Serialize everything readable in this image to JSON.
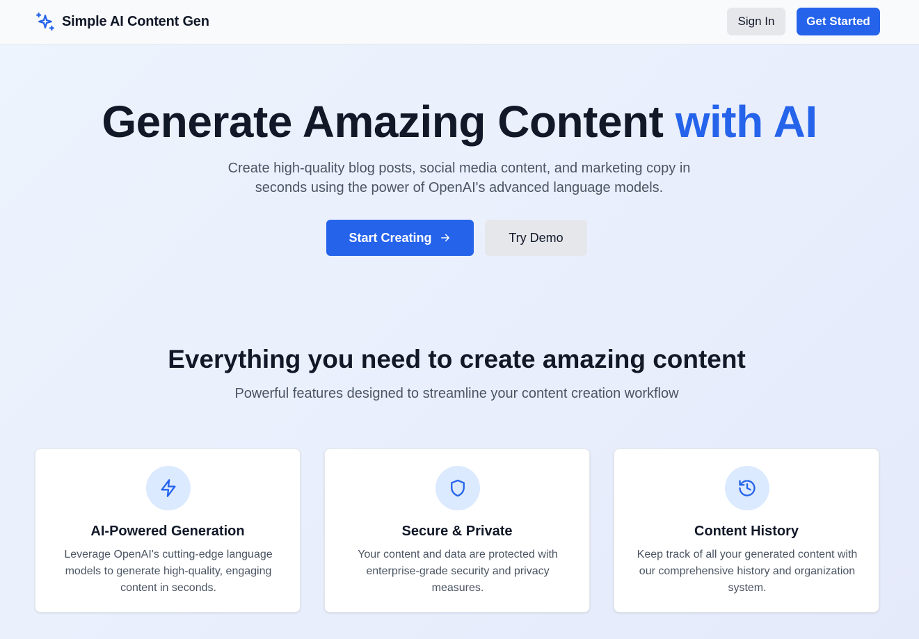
{
  "nav": {
    "brand": "Simple AI Content Gen",
    "brand_icon": "sparkles-icon",
    "signin_label": "Sign In",
    "getstarted_label": "Get Started"
  },
  "hero": {
    "title_main": "Generate Amazing Content ",
    "title_accent": "with AI",
    "subtitle": "Create high-quality blog posts, social media content, and marketing copy in seconds using the power of OpenAI's advanced language models.",
    "primary_cta": "Start Creating",
    "secondary_cta": "Try Demo"
  },
  "features": {
    "title": "Everything you need to create amazing content",
    "subtitle": "Powerful features designed to streamline your content creation workflow",
    "cards": [
      {
        "icon": "lightning-bolt-icon",
        "title": "AI-Powered Generation",
        "description": "Leverage OpenAI's cutting-edge language models to generate high-quality, engaging content in seconds."
      },
      {
        "icon": "shield-icon",
        "title": "Secure & Private",
        "description": "Your content and data are protected with enterprise-grade security and privacy measures."
      },
      {
        "icon": "history-icon",
        "title": "Content History",
        "description": "Keep track of all your generated content with our comprehensive history and organization system."
      }
    ]
  },
  "colors": {
    "accent": "#2563eb",
    "text": "#111827",
    "muted": "#4b5563",
    "icon_bg": "#dbeafe"
  }
}
